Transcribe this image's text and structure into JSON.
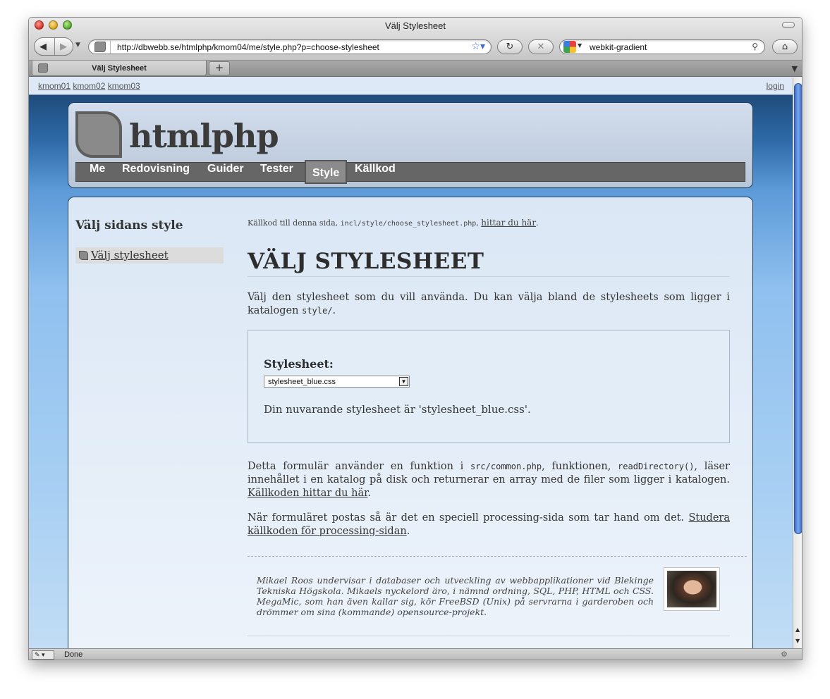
{
  "window": {
    "title": "Välj Stylesheet"
  },
  "toolbar": {
    "url": "http://dbwebb.se/htmlphp/kmom04/me/style.php?p=choose-stylesheet",
    "search": "webkit-gradient"
  },
  "tabs": [
    {
      "label": "Välj Stylesheet"
    }
  ],
  "topbar": {
    "links": [
      "kmom01",
      "kmom02",
      "kmom03"
    ],
    "login": "login"
  },
  "site": {
    "title": "htmlphp",
    "nav": [
      {
        "label": "Me"
      },
      {
        "label": "Redovisning"
      },
      {
        "label": "Guider"
      },
      {
        "label": "Tester"
      },
      {
        "label": "Style",
        "active": true
      },
      {
        "label": "Källkod"
      }
    ]
  },
  "sidebar": {
    "title": "Välj sidans style",
    "items": [
      {
        "label": "Välj stylesheet"
      }
    ]
  },
  "main": {
    "source_prefix": "Källkod till denna sida, ",
    "source_file": "incl/style/choose_stylesheet.php",
    "source_sep": ", ",
    "source_link": "hittar du här",
    "source_end": ".",
    "title": "VÄLJ STYLESHEET",
    "intro_text": "Välj den stylesheet som du vill använda. Du kan välja bland de stylesheets som ligger i katalogen ",
    "intro_code": "style/",
    "intro_end": ".",
    "form": {
      "label": "Stylesheet:",
      "selected": "stylesheet_blue.css",
      "current": "Din nuvarande stylesheet är 'stylesheet_blue.css'."
    },
    "p2_a": "Detta formulär använder en funktion i ",
    "p2_code1": "src/common.php",
    "p2_b": ", funktionen, ",
    "p2_code2": "readDirectory()",
    "p2_c": ", läser innehållet i en katalog på disk och returnerar en array med de filer som ligger i katalogen. ",
    "p2_link": "Källkoden hittar du här",
    "p2_end": ".",
    "p3_text": "När formuläret postas så är det en speciell processing-sida som tar hand om det. ",
    "p3_link": "Studera källkoden för processing-sidan",
    "p3_end": ".",
    "byline": "Mikael Roos undervisar i databaser och utveckling av webbapplikationer vid Blekinge Tekniska Högskola. Mikaels nyckelord äro, i nämnd ordning, SQL, PHP, HTML och CSS. MegaMic, som han även kallar sig, kör FreeBSD (Unix) på servrarna i garderoben och drömmer om sina (kommande) opensource-projekt."
  },
  "status": {
    "text": "Done"
  }
}
